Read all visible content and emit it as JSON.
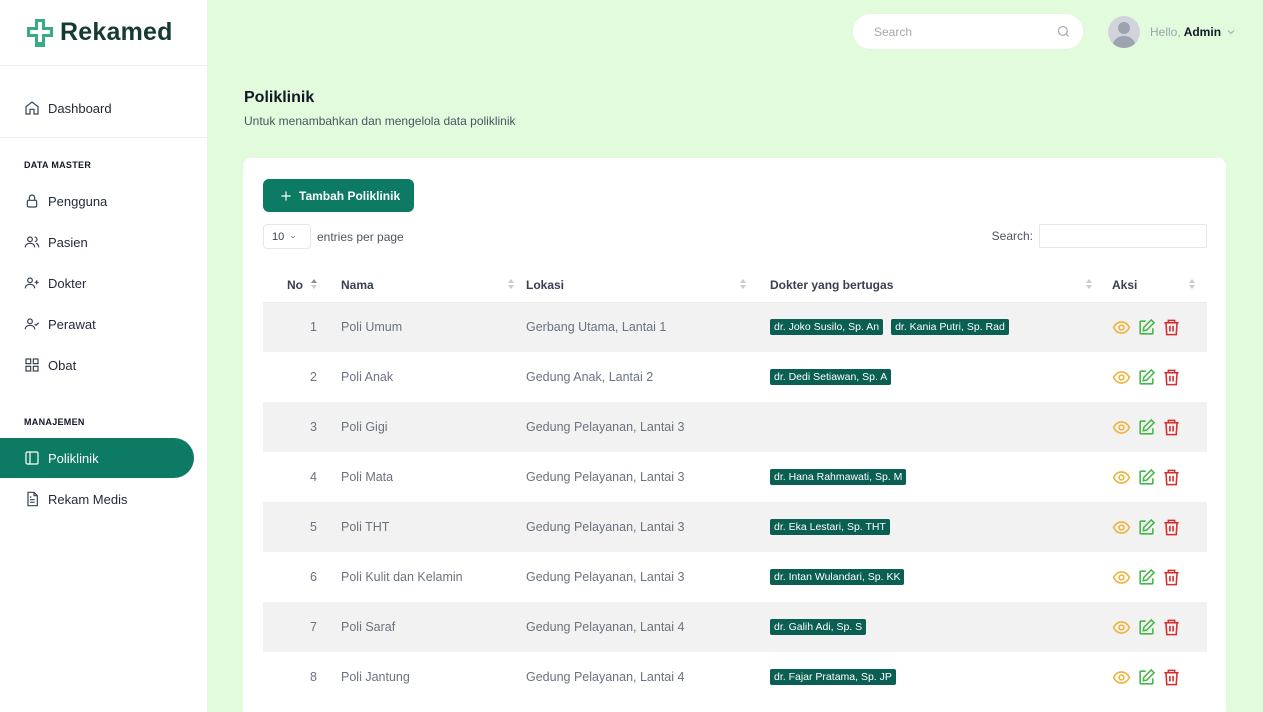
{
  "app": {
    "name": "Rekamed",
    "logo_icon": "medical-cross-logo",
    "brand_color": "#0d7a64"
  },
  "sidebar": {
    "items": [
      {
        "key": "dashboard",
        "label": "Dashboard",
        "icon": "home-icon"
      },
      {
        "key": "pengguna",
        "label": "Pengguna",
        "icon": "lock-icon"
      },
      {
        "key": "pasien",
        "label": "Pasien",
        "icon": "users-icon"
      },
      {
        "key": "dokter",
        "label": "Dokter",
        "icon": "user-plus-icon"
      },
      {
        "key": "perawat",
        "label": "Perawat",
        "icon": "user-check-icon"
      },
      {
        "key": "obat",
        "label": "Obat",
        "icon": "grid-icon"
      },
      {
        "key": "poliklinik",
        "label": "Poliklinik",
        "icon": "sidebar-panel-icon",
        "active": true
      },
      {
        "key": "rekam-medis",
        "label": "Rekam Medis",
        "icon": "file-text-icon"
      }
    ],
    "section_master": "DATA MASTER",
    "section_manajemen": "MANAJEMEN"
  },
  "topbar": {
    "search_placeholder": "Search",
    "hello": "Hello,",
    "user": "Admin"
  },
  "page": {
    "title": "Poliklinik",
    "subtitle": "Untuk menambahkan dan mengelola data poliklinik"
  },
  "toolbar": {
    "add_label": "Tambah Poliklinik",
    "per_page_value": "10",
    "per_page_label": "entries per page",
    "search_label": "Search:"
  },
  "table": {
    "headers": {
      "no": "No",
      "nama": "Nama",
      "lokasi": "Lokasi",
      "dokter": "Dokter yang bertugas",
      "aksi": "Aksi"
    },
    "rows": [
      {
        "no": "1",
        "nama": "Poli Umum",
        "lokasi": "Gerbang Utama, Lantai 1",
        "dokter": [
          "dr. Joko Susilo, Sp. An",
          "dr. Kania Putri, Sp. Rad"
        ]
      },
      {
        "no": "2",
        "nama": "Poli Anak",
        "lokasi": "Gedung Anak, Lantai 2",
        "dokter": [
          "dr. Dedi Setiawan, Sp. A"
        ]
      },
      {
        "no": "3",
        "nama": "Poli Gigi",
        "lokasi": "Gedung Pelayanan, Lantai 3",
        "dokter": []
      },
      {
        "no": "4",
        "nama": "Poli Mata",
        "lokasi": "Gedung Pelayanan, Lantai 3",
        "dokter": [
          "dr. Hana Rahmawati, Sp. M"
        ]
      },
      {
        "no": "5",
        "nama": "Poli THT",
        "lokasi": "Gedung Pelayanan, Lantai 3",
        "dokter": [
          "dr. Eka Lestari, Sp. THT"
        ]
      },
      {
        "no": "6",
        "nama": "Poli Kulit dan Kelamin",
        "lokasi": "Gedung Pelayanan, Lantai 3",
        "dokter": [
          "dr. Intan Wulandari, Sp. KK"
        ]
      },
      {
        "no": "7",
        "nama": "Poli Saraf",
        "lokasi": "Gedung Pelayanan, Lantai 4",
        "dokter": [
          "dr. Galih Adi, Sp. S"
        ]
      },
      {
        "no": "8",
        "nama": "Poli Jantung",
        "lokasi": "Gedung Pelayanan, Lantai 4",
        "dokter": [
          "dr. Fajar Pratama, Sp. JP"
        ]
      }
    ]
  }
}
